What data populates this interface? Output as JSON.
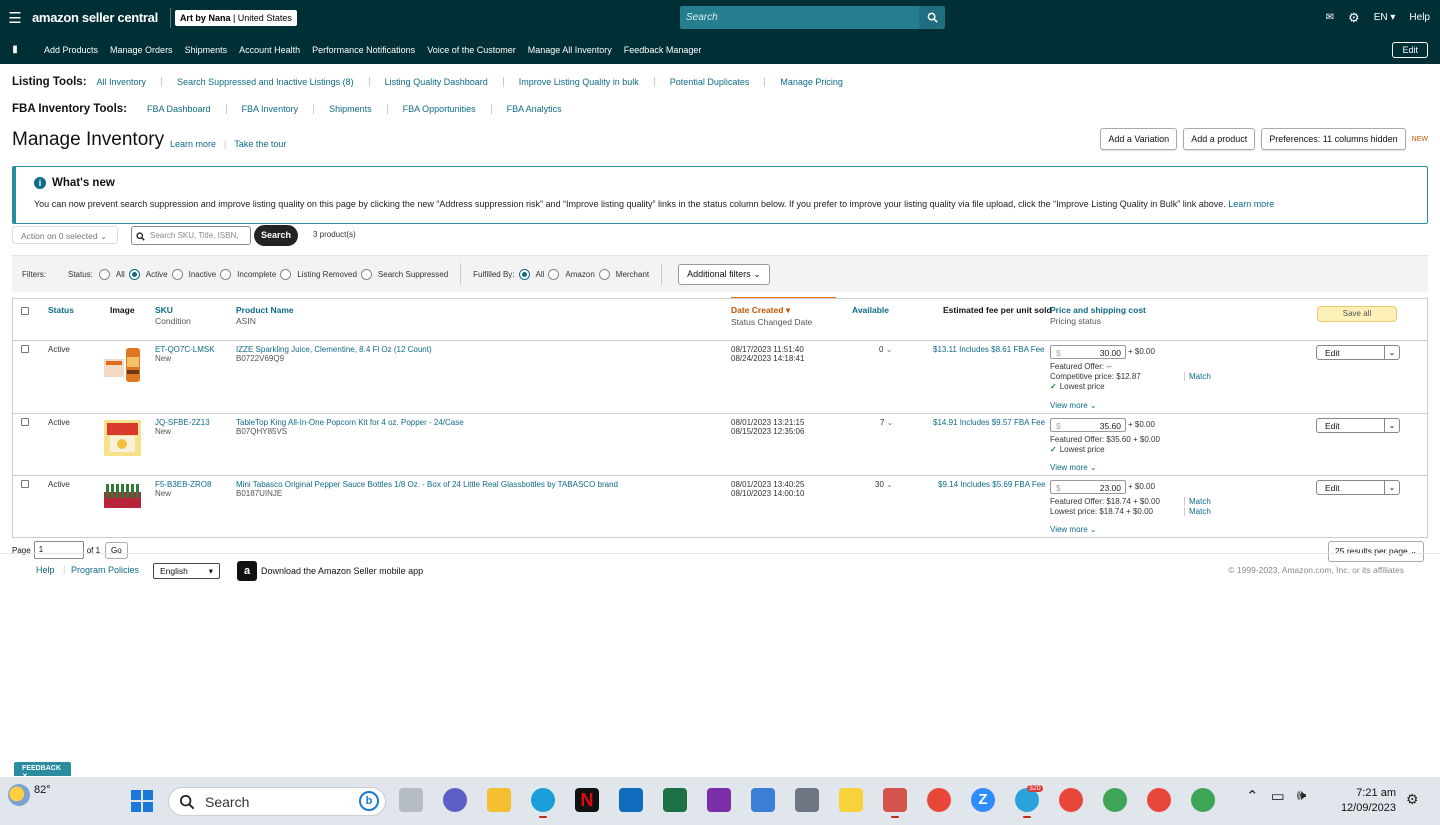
{
  "topbar": {
    "logo": "amazon seller central",
    "store_name": "Art by Nana",
    "store_country": "United States",
    "search_placeholder": "Search",
    "lang": "EN",
    "help": "Help"
  },
  "nav": {
    "items": [
      "Add Products",
      "Manage Orders",
      "Shipments",
      "Account Health",
      "Performance Notifications",
      "Voice of the Customer",
      "Manage All Inventory",
      "Feedback Manager"
    ],
    "edit": "Edit"
  },
  "listing_tools": {
    "label": "Listing Tools:",
    "items": [
      "All Inventory",
      "Search Suppressed and Inactive Listings (8)",
      "Listing Quality Dashboard",
      "Improve Listing Quality in bulk",
      "Potential Duplicates",
      "Manage Pricing"
    ]
  },
  "fba_tools": {
    "label": "FBA Inventory Tools:",
    "items": [
      "FBA Dashboard",
      "FBA Inventory",
      "Shipments",
      "FBA Opportunities",
      "FBA Analytics"
    ]
  },
  "page": {
    "title": "Manage Inventory",
    "learn_more": "Learn more",
    "tour": "Take the tour",
    "add_variation": "Add a Variation",
    "add_product": "Add a product",
    "preferences": "Preferences: 11 columns hidden",
    "new_badge": "NEW"
  },
  "whats_new": {
    "heading": "What's new",
    "body": "You can now prevent search suppression and improve listing quality on this page by clicking the new “Address suppression risk” and “Improve listing quality” links in the status column below. If you prefer to improve your listing quality via file upload, click the “Improve Listing Quality in Bulk” link above.",
    "learn_more": "Learn more"
  },
  "actions": {
    "action_select": "Action on 0 selected",
    "search_placeholder": "Search SKU, Title, ISBN,",
    "search_button": "Search",
    "product_count": "3 product(s)"
  },
  "filters": {
    "label": "Filters:",
    "status_label": "Status:",
    "status_options": [
      "All",
      "Active",
      "Inactive",
      "Incomplete",
      "Listing Removed",
      "Search Suppressed"
    ],
    "status_selected": "Active",
    "fulfilled_label": "Fulfilled By:",
    "fulfilled_options": [
      "All",
      "Amazon",
      "Merchant"
    ],
    "fulfilled_selected": "All",
    "additional": "Additional filters"
  },
  "table": {
    "headers": {
      "status": "Status",
      "image": "Image",
      "sku": "SKU",
      "sku_sub": "Condition",
      "product": "Product Name",
      "product_sub": "ASIN",
      "date": "Date Created",
      "date_sub": "Status Changed Date",
      "available": "Available",
      "fee": "Estimated fee per unit sold",
      "price": "Price and shipping cost",
      "price_sub": "Pricing status",
      "save_all": "Save all"
    },
    "rows": [
      {
        "status": "Active",
        "sku": "ET-QO7C-LMSK",
        "condition": "New",
        "name": "IZZE Sparkling Juice, Clementine, 8.4 Fl Oz (12 Count)",
        "asin": "B0722V69Q9",
        "created": "08/17/2023 11:51:40",
        "changed": "08/24/2023 14:18:41",
        "available": "0",
        "fee": "$13.11 Includes $8.61 FBA Fee",
        "price": "30.00",
        "shipping": "+ $0.00",
        "line1": "Featured Offer: --",
        "line2": "Competitive price: $12.87",
        "line2_action": "Match",
        "badge": "Lowest price",
        "view_more": "View more",
        "edit": "Edit"
      },
      {
        "status": "Active",
        "sku": "JQ-SFBE-2Z13",
        "condition": "New",
        "name": "TableTop King All-In-One Popcorn Kit for 4 oz. Popper - 24/Case",
        "asin": "B07QHY85VS",
        "created": "08/01/2023 13:21:15",
        "changed": "08/15/2023 12:35:06",
        "available": "7",
        "fee": "$14.91 Includes $9.57 FBA Fee",
        "price": "35.60",
        "shipping": "+ $0.00",
        "line1": "Featured Offer: $35.60 + $0.00",
        "badge": "Lowest price",
        "view_more": "View more",
        "edit": "Edit"
      },
      {
        "status": "Active",
        "sku": "F5-B3EB-ZRO8",
        "condition": "New",
        "name": "Mini Tabasco Original Pepper Sauce Bottles 1/8 Oz. - Box of 24 Little Real Glassbottles by TABASCO brand",
        "asin": "B0187UINJE",
        "created": "08/01/2023 13:40:25",
        "changed": "08/10/2023 14:00:10",
        "available": "30",
        "fee": "$9.14 Includes $5.69 FBA Fee",
        "price": "23.00",
        "shipping": "+ $0.00",
        "line1": "Featured Offer: $18.74 + $0.00",
        "line1_action": "Match",
        "line2": "Lowest price: $18.74 + $0.00",
        "line2_action": "Match",
        "view_more": "View more",
        "edit": "Edit"
      }
    ]
  },
  "pager": {
    "page_label": "Page",
    "page": "1",
    "of": "of 1",
    "go": "Go",
    "per_page": "25 results per page"
  },
  "footer": {
    "help": "Help",
    "policies": "Program Policies",
    "language": "English",
    "app": "Download the Amazon Seller mobile app",
    "copyright": "© 1999-2023, Amazon.com, Inc. or its affiliates"
  },
  "feedback": "FEEDBACK",
  "taskbar": {
    "weather": "82°",
    "search": "Search",
    "telegram_badge": "320",
    "time": "7:21 am",
    "date": "12/09/2023"
  }
}
